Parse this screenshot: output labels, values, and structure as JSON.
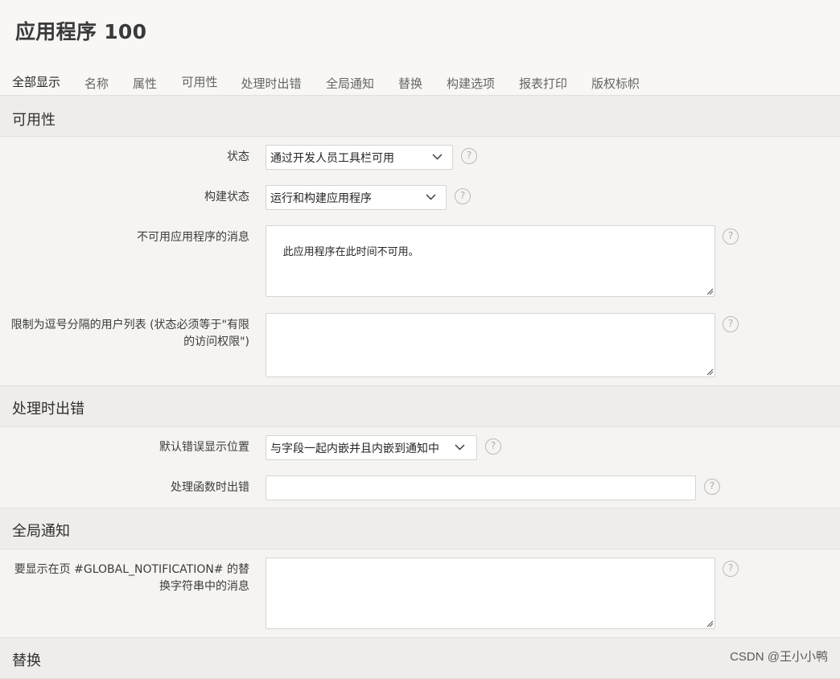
{
  "header": {
    "app_title": "应用程序 100"
  },
  "tabs": [
    {
      "label": "全部显示"
    },
    {
      "label": "名称"
    },
    {
      "label": "属性"
    },
    {
      "label": "可用性"
    },
    {
      "label": "处理时出错"
    },
    {
      "label": "全局通知"
    },
    {
      "label": "替换"
    },
    {
      "label": "构建选项"
    },
    {
      "label": "报表打印"
    },
    {
      "label": "版权标帜"
    }
  ],
  "availability": {
    "heading": "可用性",
    "status_label": "状态",
    "status_value": "通过开发人员工具栏可用",
    "build_status_label": "构建状态",
    "build_status_value": "运行和构建应用程序",
    "unavailable_msg_label": "不可用应用程序的消息",
    "unavailable_msg_value": "此应用程序在此时间不可用。",
    "restrict_users_label": "限制为逗号分隔的用户列表 (状态必须等于\"有限的访问权限\")",
    "restrict_users_value": ""
  },
  "error_handling": {
    "heading": "处理时出错",
    "default_display_label": "默认错误显示位置",
    "default_display_value": "与字段一起内嵌并且内嵌到通知中",
    "handler_fn_label": "处理函数时出错",
    "handler_fn_value": ""
  },
  "global_notification": {
    "heading": "全局通知",
    "message_label": "要显示在页 #GLOBAL_NOTIFICATION# 的替换字符串中的消息",
    "message_value": ""
  },
  "substitution": {
    "heading": "替换"
  },
  "help_glyph": "?",
  "watermark": "CSDN @王小小鸭",
  "colors": {
    "active_tab_underline": "#4a7c59",
    "section_bg": "#efedeb",
    "page_bg": "#f5f4f2"
  }
}
